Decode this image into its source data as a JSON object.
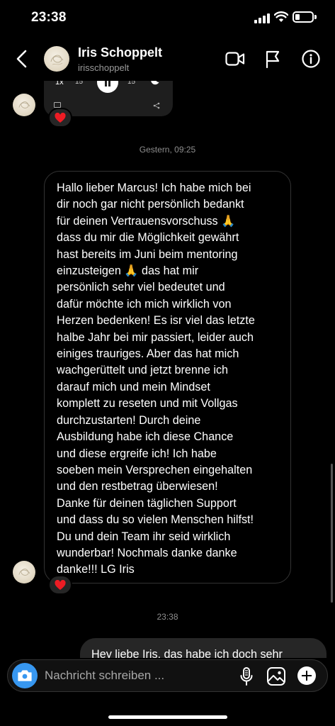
{
  "status_bar": {
    "time": "23:38"
  },
  "header": {
    "name": "Iris Schoppelt",
    "username": "irisschoppelt",
    "icons": [
      "back-icon",
      "video-call-icon",
      "flag-icon",
      "info-icon"
    ]
  },
  "audio_card": {
    "speed": "1x",
    "skip_back": "15",
    "skip_forward": "15"
  },
  "messages": {
    "timestamp_1": "Gestern, 09:25",
    "incoming_text": "Hallo lieber Marcus! Ich habe mich bei\ndir noch gar nicht persönlich bedankt\nfür deinen Vertrauensvorschuss 🙏\ndass du mir die Möglichkeit gewährt\nhast bereits im Juni beim mentoring\neinzusteigen 🙏 das hat mir\npersönlich sehr viel bedeutet und\ndafür möchte ich mich wirklich von\nHerzen bedenken! Es isr viel das letzte\nhalbe Jahr bei mir passiert, leider auch\neiniges trauriges. Aber das hat mich\nwachgerüttelt und jetzt brenne ich\ndarauf mich und mein Mindset\nkomplett zu reseten und mit Vollgas\ndurchzustarten! Durch deine\nAusbildung habe ich diese Chance\nund diese ergreife ich!  Ich habe\nsoeben mein Versprechen eingehalten\nund den restbetrag überwiesen!\nDanke für deinen täglichen Support\nund dass du so vielen Menschen hilfst!\nDu und dein Team ihr seid wirklich\nwunderbar! Nochmals danke danke\ndanke!!! LG Iris",
    "timestamp_2": "23:38",
    "outgoing_text": "Hey liebe Iris, das habe ich doch sehr"
  },
  "composer": {
    "placeholder": "Nachricht schreiben ..."
  },
  "colors": {
    "background": "#000000",
    "accent_blue": "#3797f0",
    "outgoing_bubble": "#262626",
    "heart_red": "#ed1c24"
  }
}
